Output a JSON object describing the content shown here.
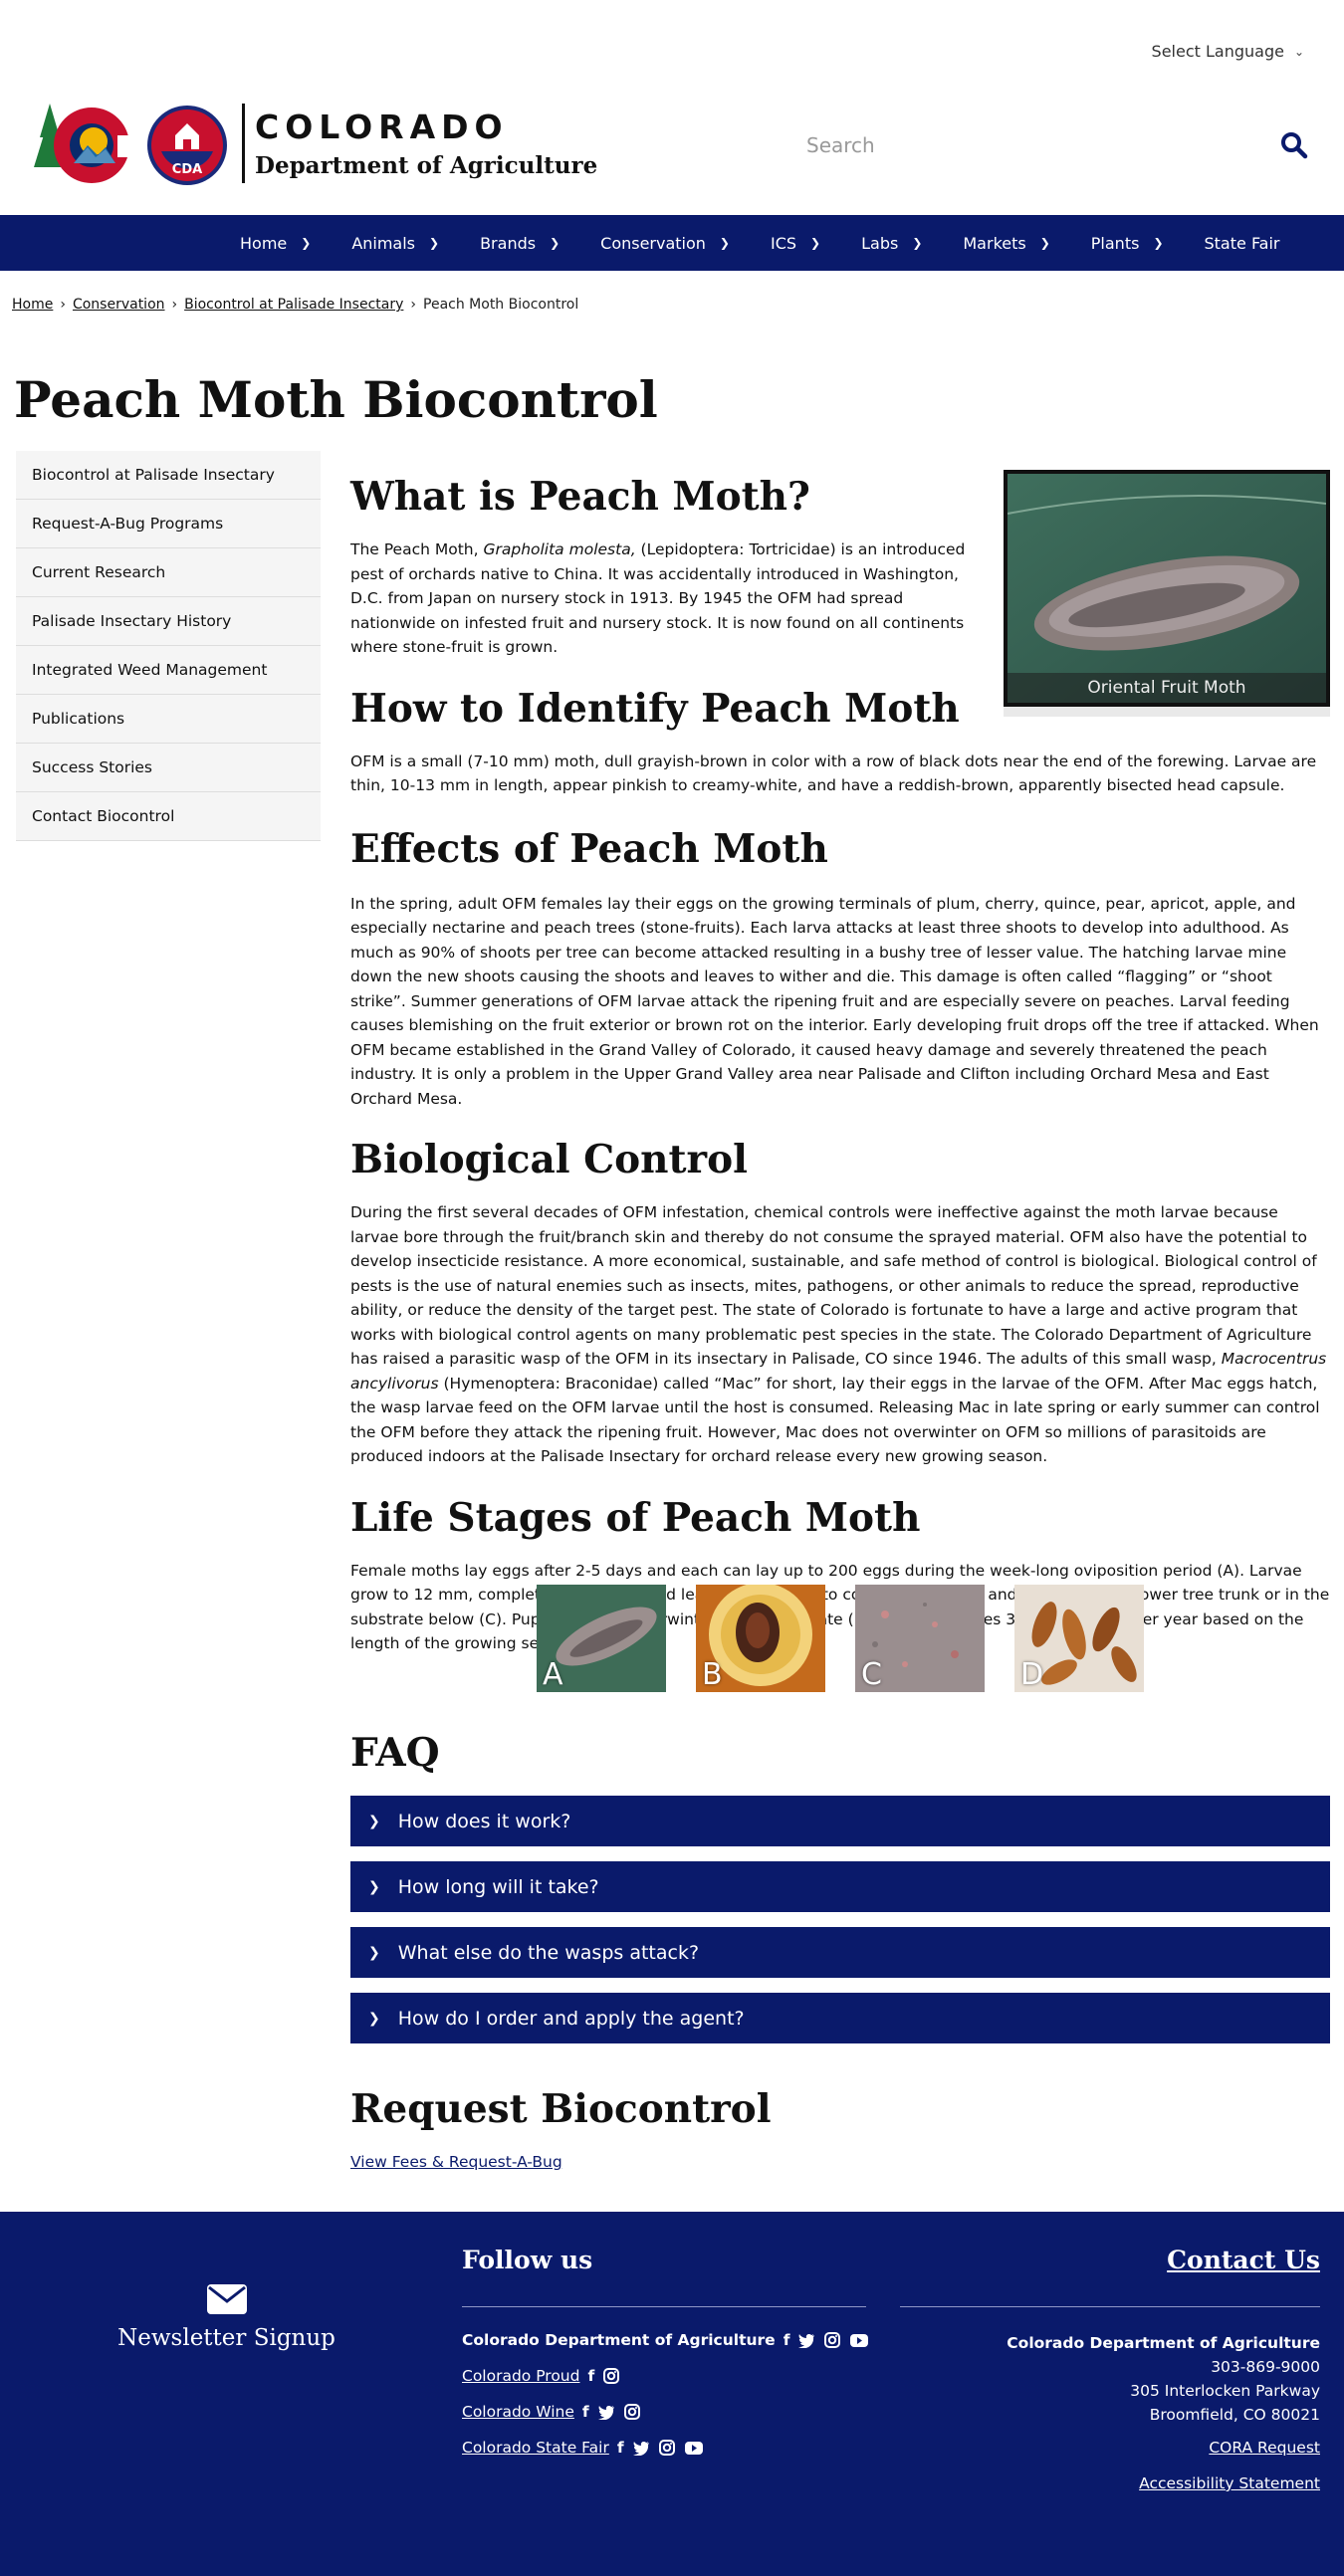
{
  "language": {
    "label": "Select Language"
  },
  "brand": {
    "line1": "COLORADO",
    "line2": "Department of Agriculture",
    "badge": "CDA"
  },
  "search": {
    "placeholder": "Search"
  },
  "nav": [
    {
      "label": "Home"
    },
    {
      "label": "Animals"
    },
    {
      "label": "Brands"
    },
    {
      "label": "Conservation"
    },
    {
      "label": "ICS"
    },
    {
      "label": "Labs"
    },
    {
      "label": "Markets"
    },
    {
      "label": "Plants"
    },
    {
      "label": "State Fair"
    }
  ],
  "breadcrumb": [
    "Home",
    "Conservation",
    "Biocontrol at Palisade Insectary",
    "Peach Moth Biocontrol"
  ],
  "page_title": "Peach Moth Biocontrol",
  "sidebar": [
    "Biocontrol at Palisade Insectary",
    "Request-A-Bug Programs",
    "Current Research",
    "Palisade Insectary History",
    "Integrated Weed Management",
    "Publications",
    "Success Stories",
    "Contact Biocontrol"
  ],
  "sections": {
    "what": {
      "heading": "What is Peach Moth?",
      "pre": "The Peach Moth, ",
      "italic": "Grapholita molesta,",
      "post": " (Lepidoptera: Tortricidae) is an introduced pest of orchards native to China. It was accidentally introduced in Washington, D.C. from Japan on nursery stock in 1913. By 1945 the OFM had spread nationwide on infested fruit and nursery stock. It is now found on all continents where stone-fruit is grown."
    },
    "identify": {
      "heading": "How to Identify Peach Moth",
      "text": "OFM is a small (7-10 mm) moth, dull grayish-brown in color with a row of black dots near the end of the forewing. Larvae are thin, 10-13 mm in length, appear pinkish to creamy-white, and have a reddish-brown, apparently bisected head capsule."
    },
    "effects": {
      "heading": "Effects of Peach Moth",
      "text": "In the spring, adult OFM females lay their eggs on the growing terminals of plum, cherry, quince, pear, apricot, apple, and especially nectarine and peach trees (stone-fruits). Each larva attacks at least three shoots to develop into adulthood. As much as 90% of shoots per tree can become attacked resulting in a bushy tree of lesser value. The hatching larvae mine down the new shoots causing the shoots and leaves to wither and die. This damage is often called “flagging” or “shoot strike”. Summer generations of OFM larvae attack the ripening fruit and are especially severe on peaches. Larval feeding causes blemishing on the fruit exterior or brown rot on the interior. Early developing fruit drops off the tree if attacked. When OFM became established in the Grand Valley of Colorado, it caused heavy damage and severely threatened the peach industry. It is only a problem in the Upper Grand Valley area near Palisade and Clifton including Orchard Mesa and East Orchard Mesa."
    },
    "bio": {
      "heading": "Biological Control",
      "pre": "During the first several decades of OFM infestation, chemical controls were ineffective against the moth larvae because larvae bore through the fruit/branch skin and thereby do not consume the sprayed material. OFM also have the potential to develop insecticide resistance. A more economical, sustainable, and safe method of control is biological. Biological control of pests is the use of natural enemies such as insects, mites, pathogens, or other animals to reduce the spread, reproductive ability, or reduce the density of the target pest. The state of Colorado is fortunate to have a large and active program that works with biological control agents on many problematic pest species in the state. The Colorado Department of Agriculture has raised a parasitic wasp of the OFM in its insectary in Palisade, CO since 1946. The adults of this small wasp, ",
      "italic": "Macrocentrus ancylivorus",
      "post": " (Hymenoptera: Braconidae) called “Mac” for short, lay their eggs in the larvae of the OFM. After Mac eggs hatch, the wasp larvae feed on the OFM larvae until the host is consumed. Releasing Mac in late spring or early summer can control the OFM before they attack the ripening fruit. However, Mac does not overwinter on OFM so millions of parasitoids are produced indoors at the Palisade Insectary for orchard release every new growing season."
    },
    "life": {
      "heading": "Life Stages of Peach Moth",
      "text": "Female moths lay eggs after 2-5 days and each can lay up to 200 eggs during the week-long oviposition period (A). Larvae grow to 12 mm, complete 4-5 instars, and leave the fruit (B) to construct cocoons and pupate on the lower tree trunk or in the substrate below (C). Pupae can also overwinter in the substrate (D). OFM completes 3-7 generations per year based on the length of the growing season."
    }
  },
  "figure_caption": "Oriental Fruit Moth",
  "stages": [
    "A",
    "B",
    "C",
    "D"
  ],
  "faq": {
    "heading": "FAQ",
    "items": [
      "How does it work?",
      "How long will it take?",
      "What else do the wasps attack?",
      "How do I order and apply the agent?"
    ]
  },
  "request": {
    "heading": "Request Biocontrol",
    "link": "View Fees & Request-A-Bug"
  },
  "footer": {
    "newsletter": "Newsletter Signup",
    "follow": "Follow us",
    "contact": "Contact Us",
    "accounts": [
      {
        "name": "Colorado Department of Agriculture",
        "icons": [
          "facebook-icon",
          "twitter-icon",
          "instagram-icon",
          "youtube-icon"
        ]
      },
      {
        "name": "Colorado Proud",
        "icons": [
          "facebook-icon",
          "instagram-icon"
        ]
      },
      {
        "name": "Colorado Wine",
        "icons": [
          "facebook-icon",
          "twitter-icon",
          "instagram-icon"
        ]
      },
      {
        "name": "Colorado State Fair",
        "icons": [
          "facebook-icon",
          "twitter-icon",
          "instagram-icon",
          "youtube-icon"
        ]
      }
    ],
    "org": "Colorado Department of Agriculture",
    "phone": "303-869-9000",
    "address1": "305 Interlocken Parkway",
    "address2": "Broomfield, CO 80021",
    "cora": "CORA Request",
    "accessibility": "Accessibility Statement"
  },
  "colors": {
    "navy": "#0a1a6b",
    "sidebar_bg": "#f5f5f5"
  }
}
